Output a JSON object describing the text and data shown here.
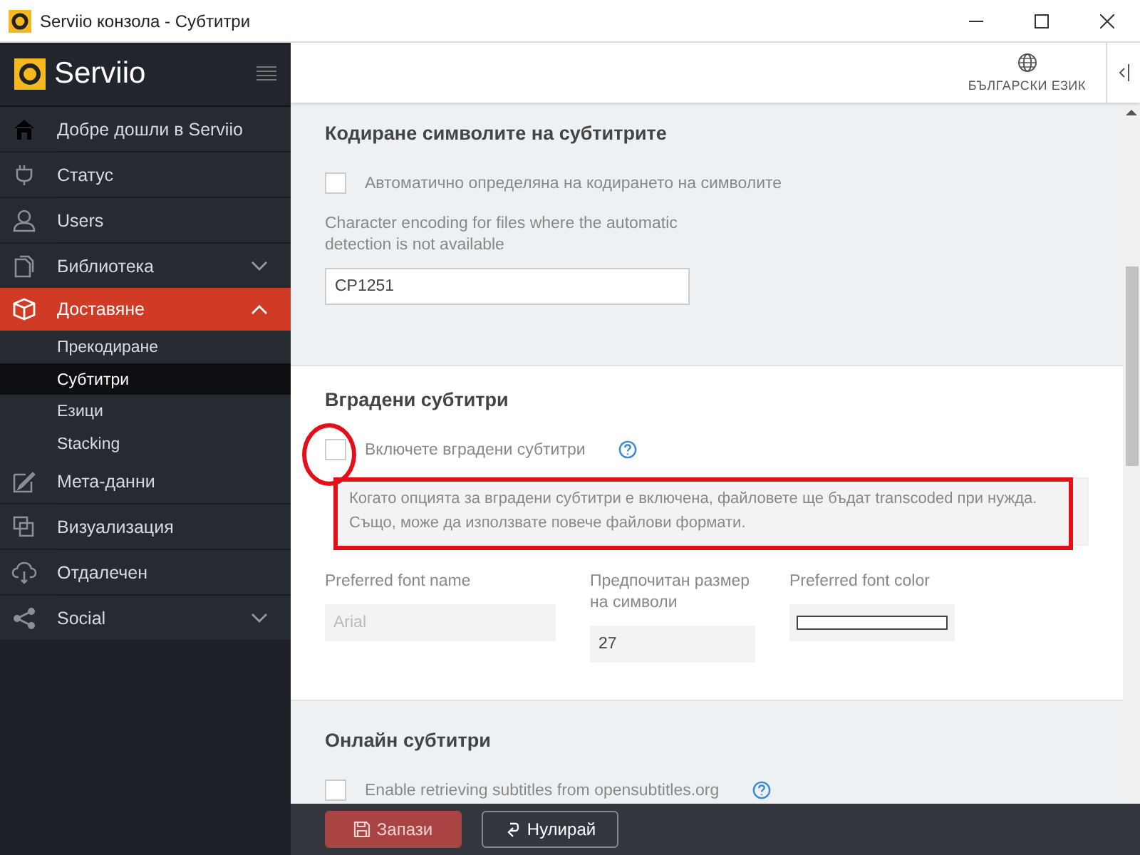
{
  "window": {
    "title": "Serviio конзола - Субтитри"
  },
  "sidebar": {
    "logo": "Serviio",
    "items": [
      {
        "label": "Добре дошли в Serviio",
        "kind": "link",
        "selected": false
      },
      {
        "label": "Статус",
        "kind": "link",
        "selected": false
      },
      {
        "label": "Users",
        "kind": "link",
        "selected": false
      },
      {
        "label": "Библиотека",
        "kind": "group",
        "selected": false,
        "expanded": false
      },
      {
        "label": "Доставяне",
        "kind": "group",
        "selected": true,
        "expanded": true,
        "children": [
          {
            "label": "Прекодиране",
            "selected": false
          },
          {
            "label": "Субтитри",
            "selected": true
          },
          {
            "label": "Езици",
            "selected": false
          },
          {
            "label": "Stacking",
            "selected": false
          }
        ]
      },
      {
        "label": "Мета-данни",
        "kind": "link",
        "selected": false
      },
      {
        "label": "Визуализация",
        "kind": "link",
        "selected": false
      },
      {
        "label": "Отдалечен",
        "kind": "link",
        "selected": false
      },
      {
        "label": "Social",
        "kind": "group",
        "selected": false,
        "expanded": false
      }
    ]
  },
  "header": {
    "language": "БЪЛГАРСКИ ЕЗИК"
  },
  "encoding": {
    "title": "Кодиране символите на субтитрите",
    "auto_detect": {
      "label": "Автоматично определяна на кодирането на символите",
      "checked": false
    },
    "fallback": {
      "label": "Character encoding for files where the automatic detection is not available",
      "value": "CP1251"
    }
  },
  "embedded": {
    "title": "Вградени субтитри",
    "enable": {
      "label": "Включете вградени субтитри",
      "checked": false
    },
    "hint": "Когато опцията за вградени субтитри е включена, файловете ще бъдат transcoded при нужда. Също, може да използвате повече файлови формати.",
    "font_name": {
      "label": "Preferred font name",
      "value": "Arial",
      "disabled": true
    },
    "font_size": {
      "label": "Предпочитан размер на символи",
      "value": "27",
      "disabled": false
    },
    "font_color": {
      "label": "Preferred font color"
    }
  },
  "online": {
    "title": "Онлайн субтитри",
    "enable": {
      "label": "Enable retrieving subtitles from opensubtitles.org",
      "checked": false
    }
  },
  "footer": {
    "buttons": [
      {
        "label": "Запази",
        "kind": "primary"
      },
      {
        "label": "Нулирай",
        "kind": "secondary"
      }
    ]
  }
}
